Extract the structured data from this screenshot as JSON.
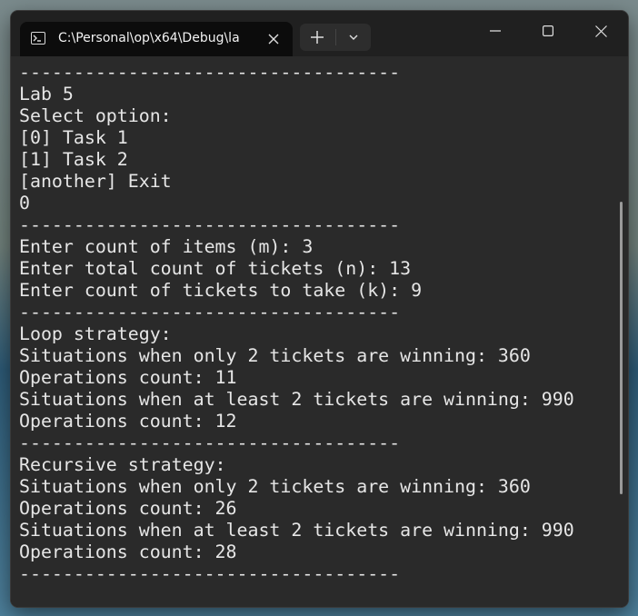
{
  "window": {
    "tab_title": "C:\\Personal\\op\\x64\\Debug\\la",
    "icons": {
      "tab": "terminal-icon",
      "tab_close": "close-icon",
      "new_tab": "plus-icon",
      "dropdown": "chevron-down-icon",
      "minimize": "minimize-icon",
      "maximize": "maximize-icon",
      "close": "close-icon"
    }
  },
  "terminal": {
    "lines": [
      "-----------------------------------",
      "Lab 5",
      "Select option:",
      "[0] Task 1",
      "[1] Task 2",
      "[another] Exit",
      "0",
      "-----------------------------------",
      "Enter count of items (m): 3",
      "Enter total count of tickets (n): 13",
      "Enter count of tickets to take (k): 9",
      "-----------------------------------",
      "Loop strategy:",
      "Situations when only 2 tickets are winning: 360",
      "Operations count: 11",
      "Situations when at least 2 tickets are winning: 990",
      "Operations count: 12",
      "-----------------------------------",
      "Recursive strategy:",
      "Situations when only 2 tickets are winning: 360",
      "Operations count: 26",
      "Situations when at least 2 tickets are winning: 990",
      "Operations count: 28",
      "-----------------------------------"
    ]
  },
  "colors": {
    "terminal_bg": "#2a2a2a",
    "text": "#e6e6e6",
    "titlebar": "#202020"
  }
}
